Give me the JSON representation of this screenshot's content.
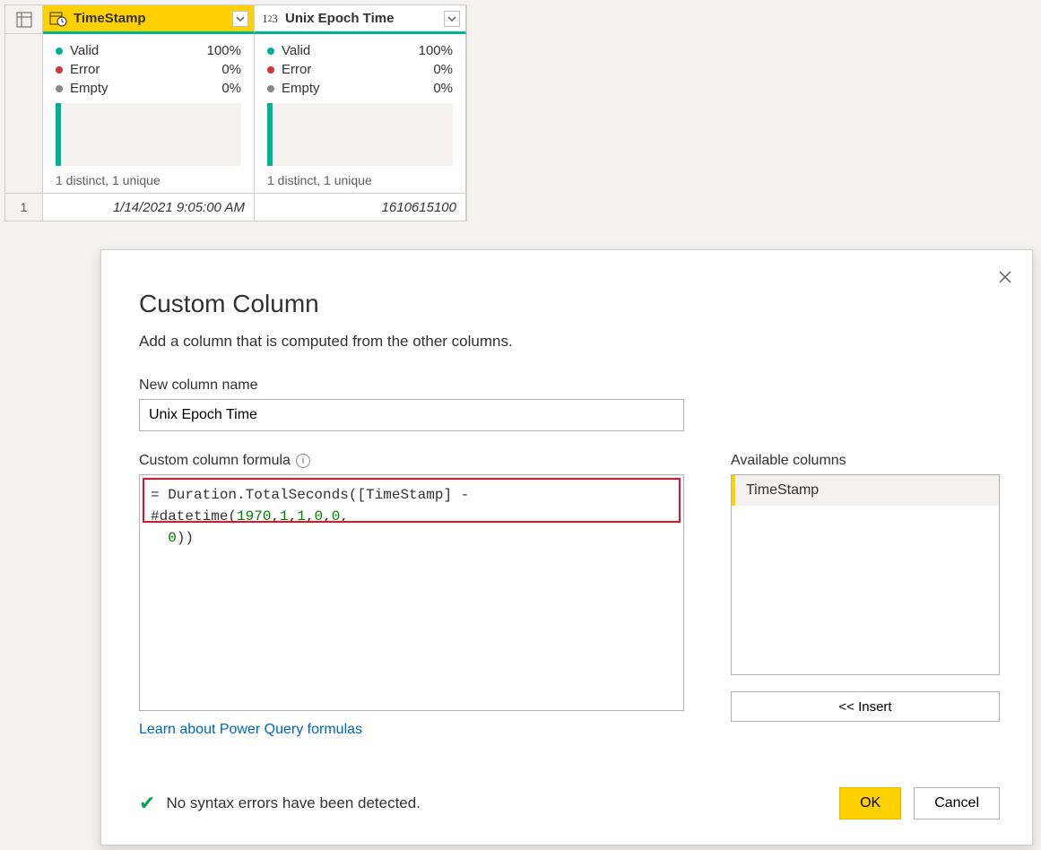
{
  "grid": {
    "rowNumber": "1",
    "columns": [
      {
        "name": "TimeStamp",
        "selected": true,
        "typeIcon": "datetime",
        "quality": {
          "valid_label": "Valid",
          "valid_pct": "100%",
          "error_label": "Error",
          "error_pct": "0%",
          "empty_label": "Empty",
          "empty_pct": "0%"
        },
        "summary": "1 distinct, 1 unique",
        "value": "1/14/2021 9:05:00 AM"
      },
      {
        "name": "Unix Epoch Time",
        "selected": false,
        "typeIcon": "number",
        "quality": {
          "valid_label": "Valid",
          "valid_pct": "100%",
          "error_label": "Error",
          "error_pct": "0%",
          "empty_label": "Empty",
          "empty_pct": "0%"
        },
        "summary": "1 distinct, 1 unique",
        "value": "1610615100"
      }
    ]
  },
  "dialog": {
    "title": "Custom Column",
    "subtitle": "Add a column that is computed from the other columns.",
    "new_col_label": "New column name",
    "new_col_value": "Unix Epoch Time",
    "formula_label": "Custom column formula",
    "formula_parts": {
      "p1": "= Duration.TotalSeconds([TimeStamp] - #datetime(",
      "n1": "1970",
      "c": ",",
      "n2": "1",
      "n3": "1",
      "n4": "0",
      "n5": "0",
      "p2": ",\n  ",
      "n6": "0",
      "p3": "))"
    },
    "learn_link": "Learn about Power Query formulas",
    "available_label": "Available columns",
    "available_items": [
      "TimeStamp"
    ],
    "insert_label": "<< Insert",
    "status_text": "No syntax errors have been detected.",
    "ok_label": "OK",
    "cancel_label": "Cancel"
  }
}
